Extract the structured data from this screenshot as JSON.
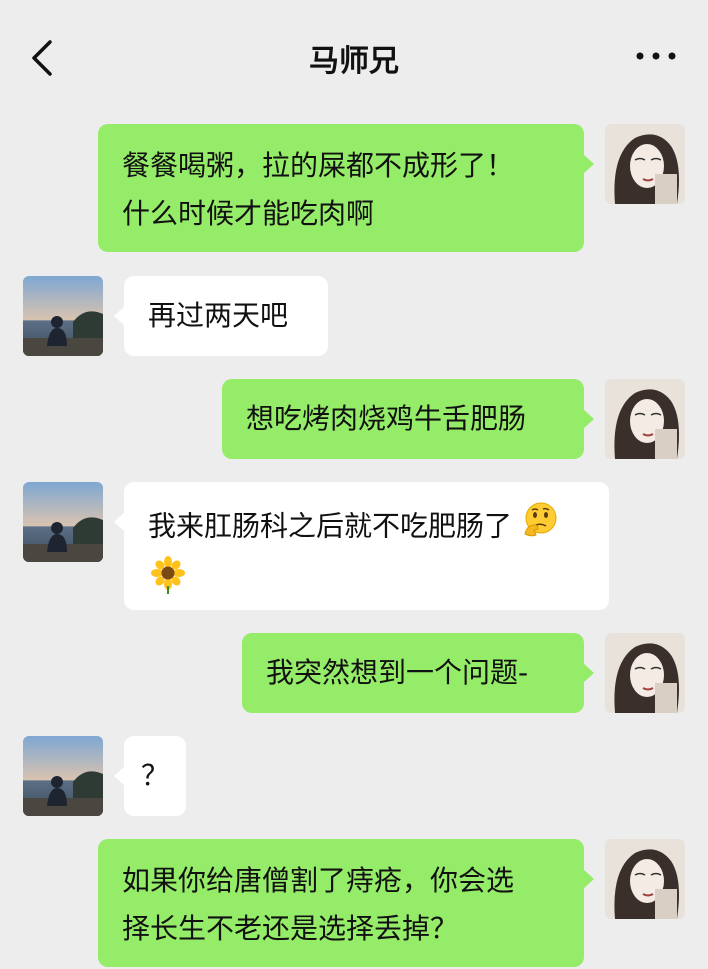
{
  "header": {
    "title": "马师兄",
    "back_icon": "chevron-left-icon",
    "more_icon": "more-dots-icon"
  },
  "colors": {
    "outgoing_bubble": "#95ec69",
    "incoming_bubble": "#ffffff",
    "background": "#ededed"
  },
  "messages": [
    {
      "direction": "out",
      "lines": [
        "餐餐喝粥，拉的屎都不成形了！",
        "什么时候才能吃肉啊"
      ]
    },
    {
      "direction": "in",
      "lines": [
        "再过两天吧"
      ]
    },
    {
      "direction": "out",
      "lines": [
        "想吃烤肉烧鸡牛舌肥肠"
      ]
    },
    {
      "direction": "in",
      "lines": [
        "我来肛肠科之后就不吃肥肠了"
      ],
      "emojis": [
        "thinking-face-emoji",
        "sunflower-emoji"
      ]
    },
    {
      "direction": "out",
      "lines": [
        "我突然想到一个问题-"
      ]
    },
    {
      "direction": "in",
      "lines": [
        "？"
      ]
    },
    {
      "direction": "out",
      "lines": [
        "如果你给唐僧割了痔疮，你会选",
        "择长生不老还是选择丢掉？"
      ]
    }
  ]
}
